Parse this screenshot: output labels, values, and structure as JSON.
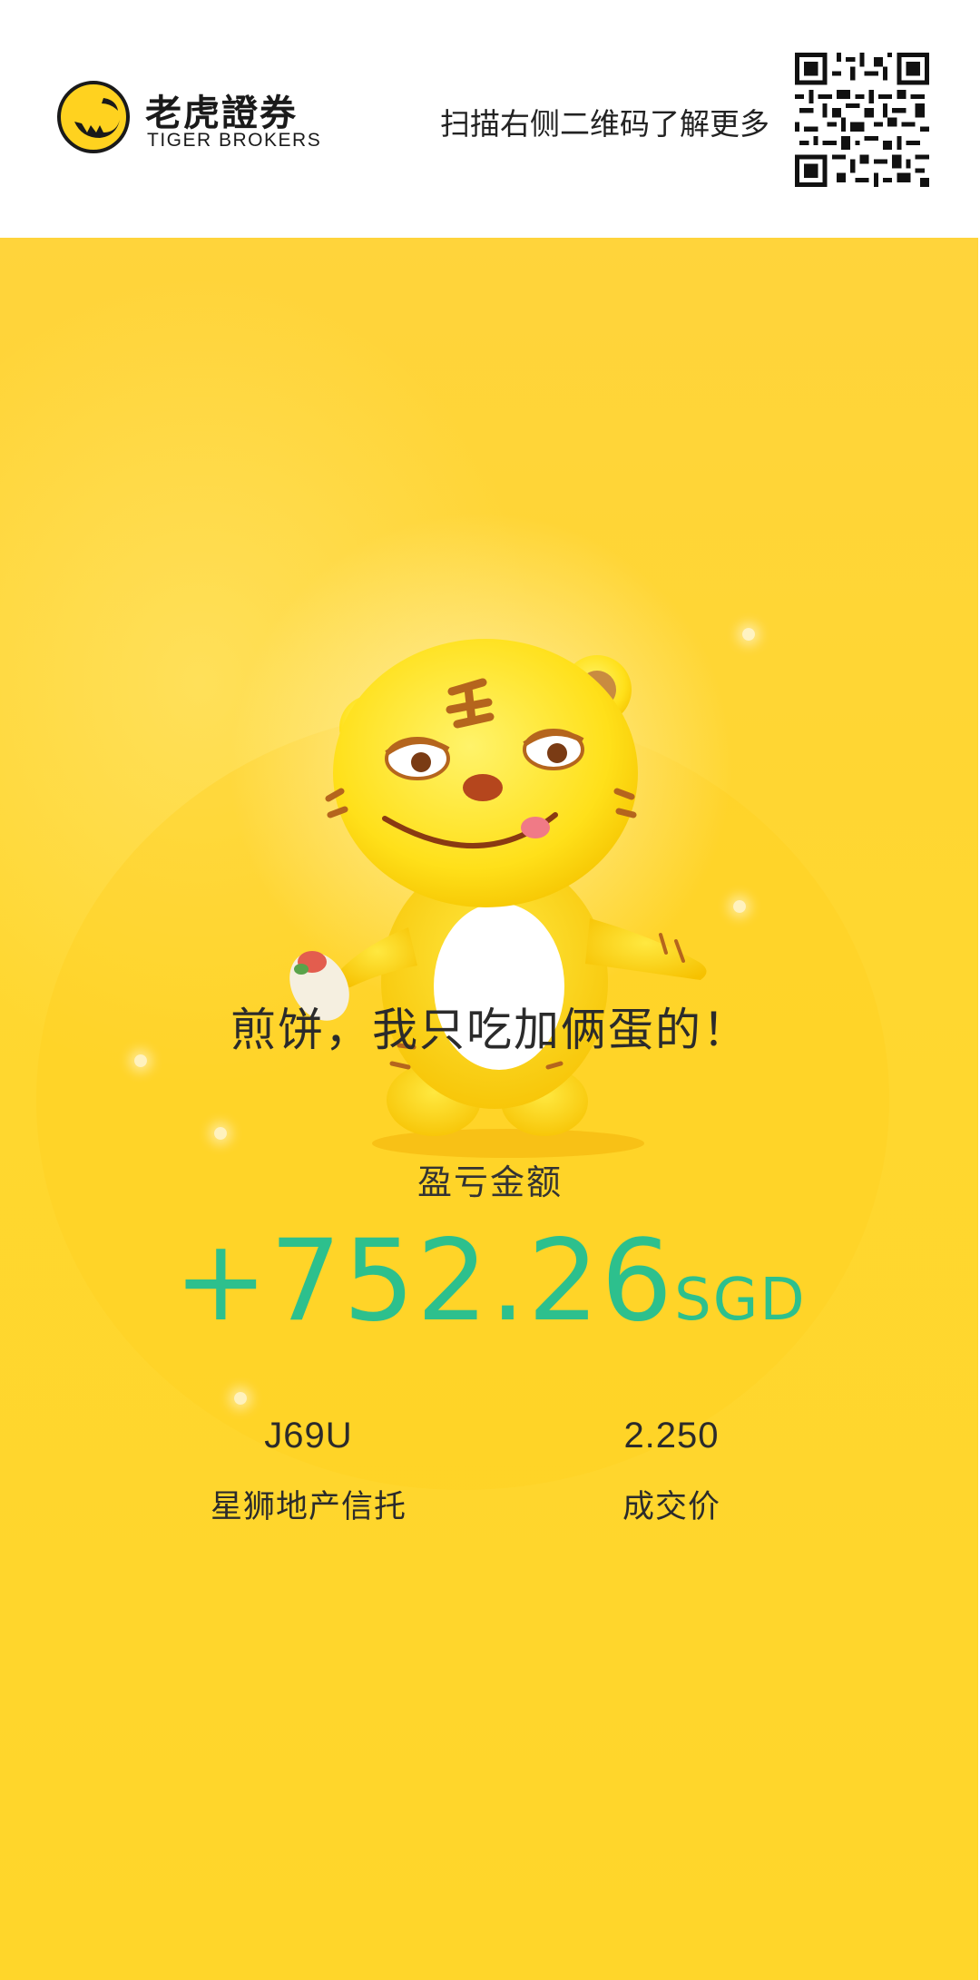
{
  "header": {
    "brand_cn": "老虎證券",
    "brand_en": "TIGER BROKERS",
    "scan_hint": "扫描右侧二维码了解更多",
    "logo_icon": "tiger-logo-icon",
    "qr_icon": "qr-code-icon"
  },
  "card": {
    "mascot_icon": "tiger-mascot-illustration",
    "slogan": "煎饼，我只吃加俩蛋的！",
    "pl_label": "盈亏金额",
    "pl_value": "+752.26",
    "pl_currency": "SGD",
    "stock_code": "J69U",
    "stock_name": "星狮地产信托",
    "price_value": "2.250",
    "price_label": "成交价"
  },
  "colors": {
    "background": "#ffd43b",
    "profit_green": "#2dc08d",
    "logo_yellow": "#ffd21f"
  }
}
